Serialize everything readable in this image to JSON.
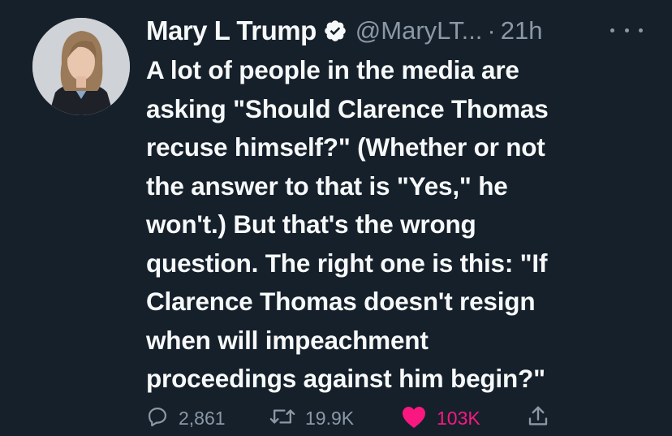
{
  "tweet": {
    "display_name": "Mary L Trump",
    "handle": "@MaryLT...",
    "separator": "·",
    "time": "21h",
    "text": "A lot of people in the media are\nasking \"Should Clarence Thomas\nrecuse himself?\" (Whether or not\nthe answer to that is \"Yes,\" he\nwon't.) But that's the wrong\nquestion. The right one is this: \"If\nClarence Thomas doesn't resign\nwhen will impeachment\nproceedings against him begin?\"",
    "verified": true
  },
  "actions": {
    "reply_count": "2,861",
    "retweet_count": "19.9K",
    "like_count": "103K"
  },
  "icons": {
    "verified": "verified-badge-icon",
    "more": "more-icon",
    "reply": "reply-icon",
    "retweet": "retweet-icon",
    "like": "heart-icon",
    "share": "share-icon"
  },
  "colors": {
    "background": "#15202b",
    "text": "#f7f9f9",
    "secondary": "#8b98a5",
    "like": "#f91880"
  }
}
